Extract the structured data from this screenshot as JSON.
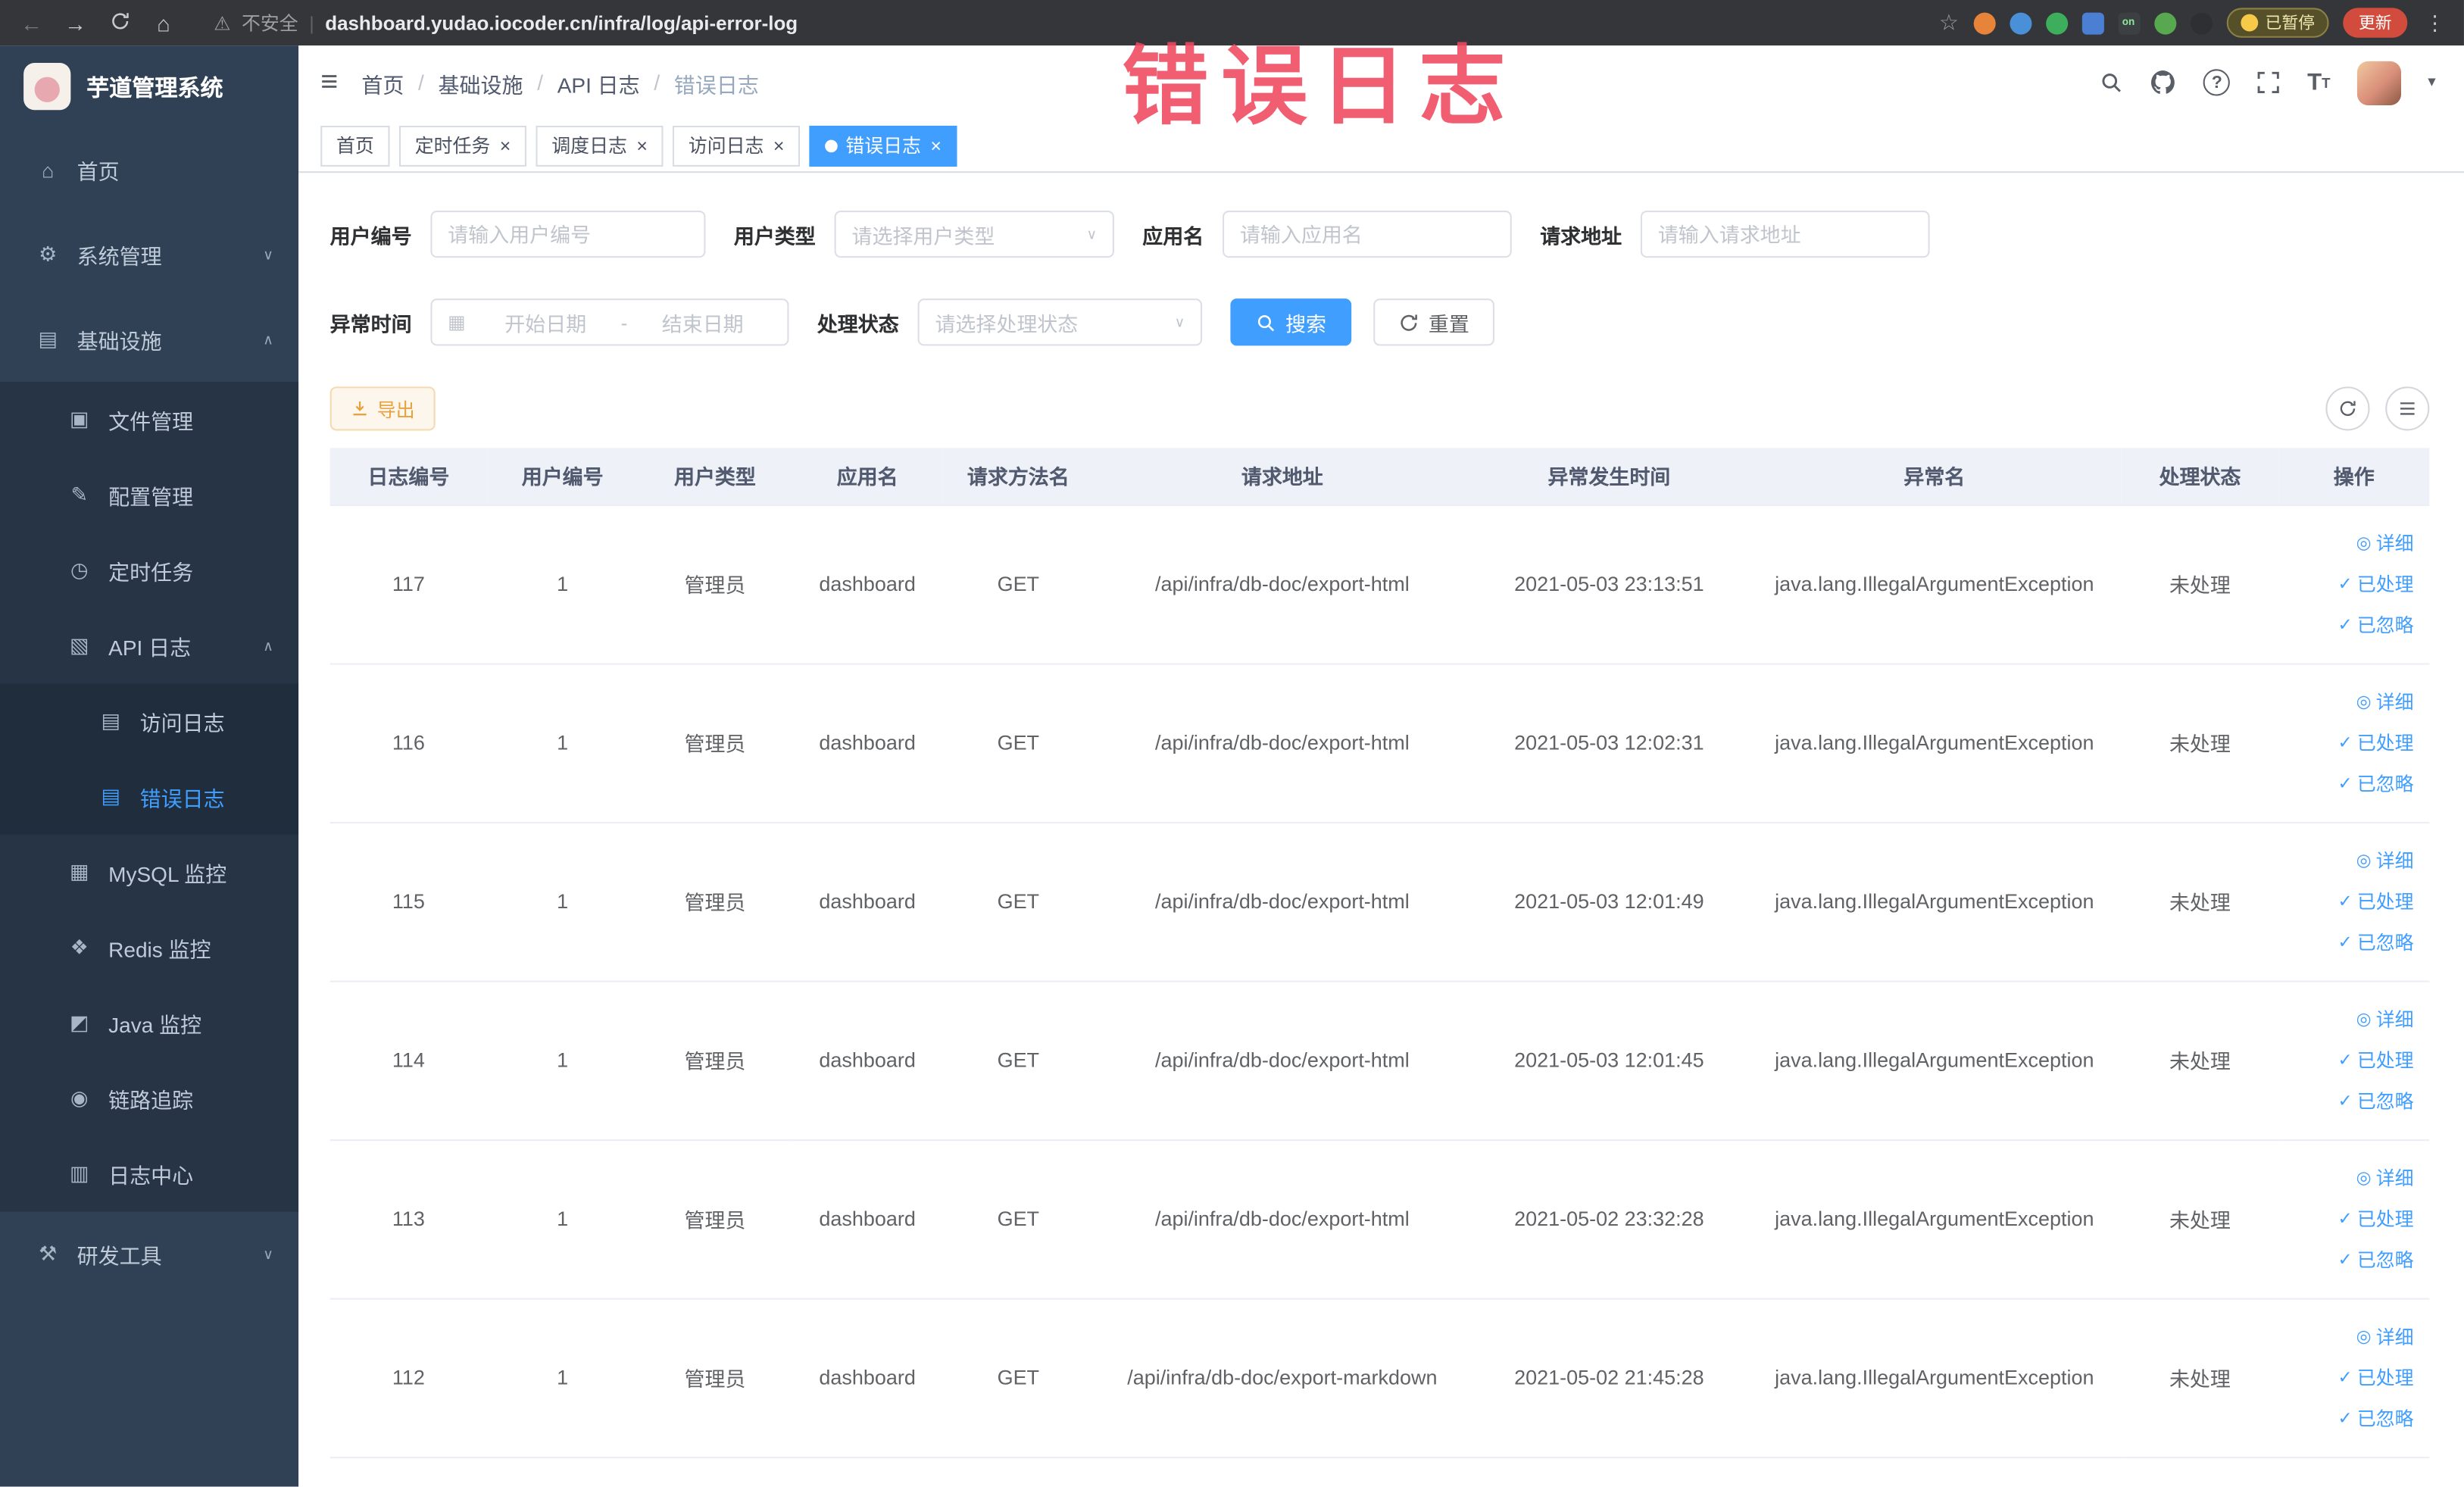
{
  "browser": {
    "security_label": "不安全",
    "url": "dashboard.yudao.iocoder.cn/infra/log/api-error-log",
    "paused_badge": "已暂停",
    "update_button": "更新"
  },
  "watermark": "错误日志",
  "colors": {
    "accent": "#409eff",
    "sidebar_bg": "#304156",
    "submenu_bg": "#1f2d3d",
    "export_text": "#e6a23c",
    "watermark": "#f0485f",
    "table_header_bg": "#eef2f8"
  },
  "icons": {
    "home-icon": "⌂",
    "gear-icon": "⚙",
    "infrastructure-icon": "▤",
    "file-icon": "▣",
    "config-icon": "✎",
    "timer-icon": "◷",
    "api-log-icon": "▧",
    "access-log-icon": "▤",
    "error-log-icon": "▤",
    "mysql-icon": "▦",
    "redis-icon": "❖",
    "java-icon": "◩",
    "trace-icon": "◉",
    "log-center-icon": "▥",
    "tools-icon": "⚒",
    "eye-icon": "◎",
    "check-icon": "✓",
    "chevron-down": "∨",
    "chevron-up": "∧"
  },
  "sidebar": {
    "logo_title": "芋道管理系统",
    "items": [
      {
        "name": "home",
        "label": "首页",
        "icon": "home-icon",
        "level": 1
      },
      {
        "name": "system-management",
        "label": "系统管理",
        "icon": "gear-icon",
        "level": 1,
        "chevron": "down"
      },
      {
        "name": "infrastructure",
        "label": "基础设施",
        "icon": "infrastructure-icon",
        "level": 1,
        "chevron": "up"
      },
      {
        "name": "file-management",
        "label": "文件管理",
        "icon": "file-icon",
        "level": 2
      },
      {
        "name": "config-management",
        "label": "配置管理",
        "icon": "config-icon",
        "level": 2
      },
      {
        "name": "scheduled-jobs",
        "label": "定时任务",
        "icon": "timer-icon",
        "level": 2
      },
      {
        "name": "api-log",
        "label": "API 日志",
        "icon": "api-log-icon",
        "level": 2,
        "chevron": "up"
      },
      {
        "name": "access-log",
        "label": "访问日志",
        "icon": "access-log-icon",
        "level": 3
      },
      {
        "name": "error-log",
        "label": "错误日志",
        "icon": "error-log-icon",
        "level": 3,
        "active": true
      },
      {
        "name": "mysql-monitor",
        "label": "MySQL 监控",
        "icon": "mysql-icon",
        "level": 2
      },
      {
        "name": "redis-monitor",
        "label": "Redis 监控",
        "icon": "redis-icon",
        "level": 2
      },
      {
        "name": "java-monitor",
        "label": "Java 监控",
        "icon": "java-icon",
        "level": 2
      },
      {
        "name": "trace",
        "label": "链路追踪",
        "icon": "trace-icon",
        "level": 2
      },
      {
        "name": "log-center",
        "label": "日志中心",
        "icon": "log-center-icon",
        "level": 2
      },
      {
        "name": "dev-tools",
        "label": "研发工具",
        "icon": "tools-icon",
        "level": 1,
        "chevron": "down"
      }
    ]
  },
  "breadcrumb": [
    "首页",
    "基础设施",
    "API 日志",
    "错误日志"
  ],
  "tabs": [
    {
      "name": "home",
      "label": "首页",
      "closable": false,
      "active": false
    },
    {
      "name": "scheduled-jobs",
      "label": "定时任务",
      "closable": true,
      "active": false
    },
    {
      "name": "schedule-log",
      "label": "调度日志",
      "closable": true,
      "active": false
    },
    {
      "name": "access-log",
      "label": "访问日志",
      "closable": true,
      "active": false
    },
    {
      "name": "error-log",
      "label": "错误日志",
      "closable": true,
      "active": true
    }
  ],
  "filters": {
    "user_id": {
      "label": "用户编号",
      "placeholder": "请输入用户编号"
    },
    "user_type": {
      "label": "用户类型",
      "placeholder": "请选择用户类型"
    },
    "app_name": {
      "label": "应用名",
      "placeholder": "请输入应用名"
    },
    "request_url": {
      "label": "请求地址",
      "placeholder": "请输入请求地址"
    },
    "exception_time": {
      "label": "异常时间",
      "start_placeholder": "开始日期",
      "separator": "-",
      "end_placeholder": "结束日期"
    },
    "process_status": {
      "label": "处理状态",
      "placeholder": "请选择处理状态"
    },
    "search_label": "搜索",
    "reset_label": "重置"
  },
  "toolbar": {
    "export_label": "导出"
  },
  "table": {
    "columns": [
      "日志编号",
      "用户编号",
      "用户类型",
      "应用名",
      "请求方法名",
      "请求地址",
      "异常发生时间",
      "异常名",
      "处理状态",
      "操作"
    ],
    "rows": [
      {
        "id": "117",
        "user_id": "1",
        "user_type": "管理员",
        "app_name": "dashboard",
        "method": "GET",
        "url": "/api/infra/db-doc/export-html",
        "time": "2021-05-03 23:13:51",
        "exception": "java.lang.IllegalArgumentException",
        "status": "未处理"
      },
      {
        "id": "116",
        "user_id": "1",
        "user_type": "管理员",
        "app_name": "dashboard",
        "method": "GET",
        "url": "/api/infra/db-doc/export-html",
        "time": "2021-05-03 12:02:31",
        "exception": "java.lang.IllegalArgumentException",
        "status": "未处理"
      },
      {
        "id": "115",
        "user_id": "1",
        "user_type": "管理员",
        "app_name": "dashboard",
        "method": "GET",
        "url": "/api/infra/db-doc/export-html",
        "time": "2021-05-03 12:01:49",
        "exception": "java.lang.IllegalArgumentException",
        "status": "未处理"
      },
      {
        "id": "114",
        "user_id": "1",
        "user_type": "管理员",
        "app_name": "dashboard",
        "method": "GET",
        "url": "/api/infra/db-doc/export-html",
        "time": "2021-05-03 12:01:45",
        "exception": "java.lang.IllegalArgumentException",
        "status": "未处理"
      },
      {
        "id": "113",
        "user_id": "1",
        "user_type": "管理员",
        "app_name": "dashboard",
        "method": "GET",
        "url": "/api/infra/db-doc/export-html",
        "time": "2021-05-02 23:32:28",
        "exception": "java.lang.IllegalArgumentException",
        "status": "未处理"
      },
      {
        "id": "112",
        "user_id": "1",
        "user_type": "管理员",
        "app_name": "dashboard",
        "method": "GET",
        "url": "/api/infra/db-doc/export-markdown",
        "time": "2021-05-02 21:45:28",
        "exception": "java.lang.IllegalArgumentException",
        "status": "未处理"
      }
    ],
    "actions": [
      {
        "name": "detail",
        "label": "详细",
        "icon": "eye-icon"
      },
      {
        "name": "processed",
        "label": "已处理",
        "icon": "check-icon"
      },
      {
        "name": "ignored",
        "label": "已忽略",
        "icon": "check-icon"
      }
    ]
  }
}
